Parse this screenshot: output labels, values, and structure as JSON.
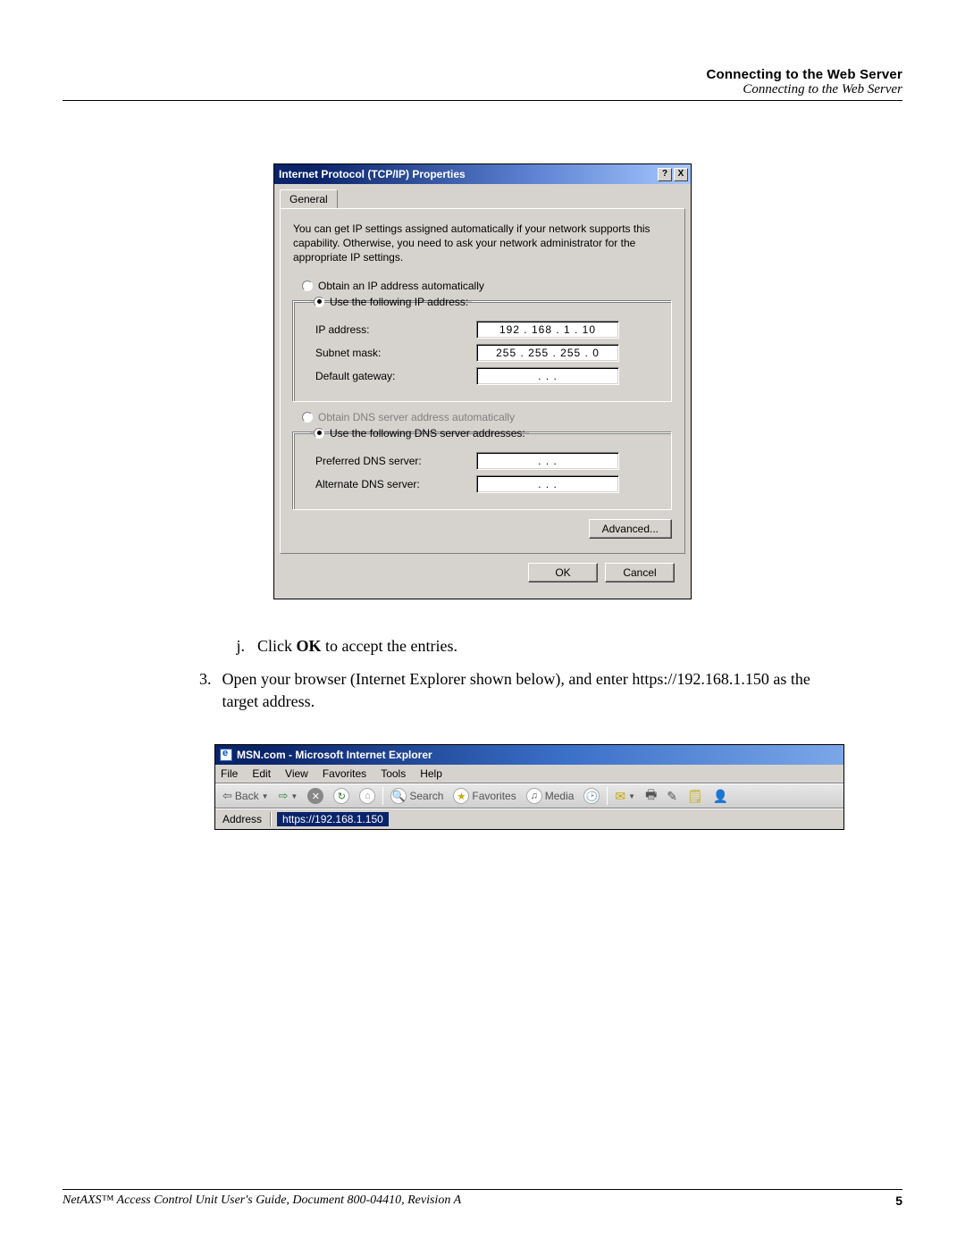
{
  "header": {
    "bold": "Connecting to the Web Server",
    "italic": "Connecting to the Web Server"
  },
  "dialog": {
    "title": "Internet Protocol (TCP/IP) Properties",
    "help_glyph": "?",
    "close_glyph": "X",
    "tab_general": "General",
    "desc": "You can get IP settings assigned automatically if your network supports this capability. Otherwise, you need to ask your network administrator for the appropriate IP settings.",
    "ip": {
      "auto": "Obtain an IP address automatically",
      "use": "Use the following IP address:",
      "ip_label": "IP address:",
      "ip_value": "192 . 168 .   1   .  10",
      "subnet_label": "Subnet mask:",
      "subnet_value": "255 . 255 . 255 .   0",
      "gateway_label": "Default gateway:",
      "gateway_value": ".          .          ."
    },
    "dns": {
      "auto": "Obtain DNS server address automatically",
      "use": "Use the following DNS server addresses:",
      "pref_label": "Preferred DNS server:",
      "pref_value": ".          .          .",
      "alt_label": "Alternate DNS server:",
      "alt_value": ".          .          ."
    },
    "advanced": "Advanced...",
    "ok": "OK",
    "cancel": "Cancel"
  },
  "doc": {
    "step_j_marker": "j.",
    "step_j_pre": "Click ",
    "step_j_bold": "OK",
    "step_j_post": " to accept the entries.",
    "step_3_marker": "3.",
    "step_3_text": "Open your browser (Internet Explorer shown below), and enter https://192.168.1.150 as the target address."
  },
  "ie": {
    "title": "MSN.com - Microsoft Internet Explorer",
    "menu": {
      "file": "File",
      "edit": "Edit",
      "view": "View",
      "favorites": "Favorites",
      "tools": "Tools",
      "help": "Help"
    },
    "toolbar": {
      "back": "Back",
      "search": "Search",
      "favorites": "Favorites",
      "media": "Media"
    },
    "address_label": "Address",
    "address_value": "https://192.168.1.150"
  },
  "footer": {
    "left": "NetAXS™ Access Control Unit User's Guide, Document 800-04410, Revision A",
    "right": "5"
  }
}
